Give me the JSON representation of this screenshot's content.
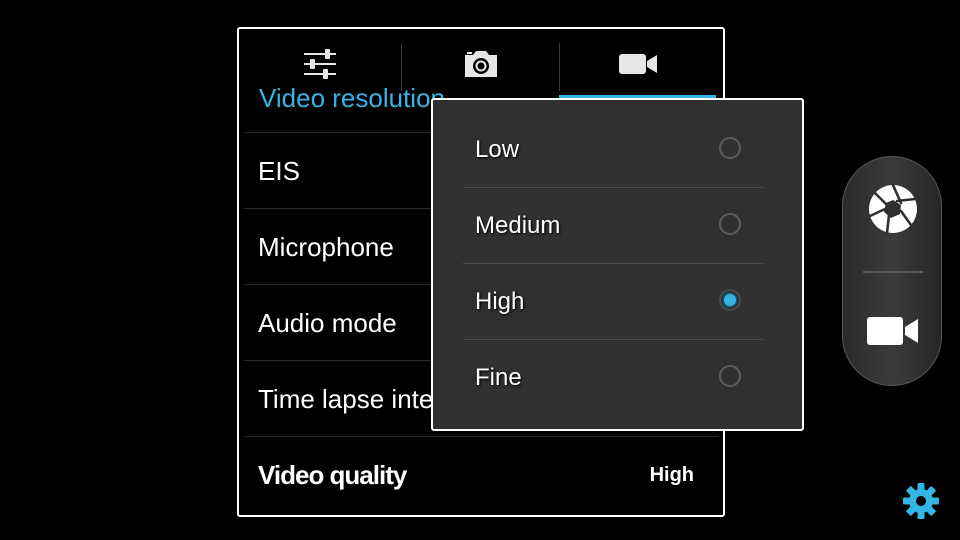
{
  "tabs": [
    {
      "icon": "sliders-icon",
      "active": false
    },
    {
      "icon": "camera-icon",
      "active": false
    },
    {
      "icon": "video-camera-icon",
      "active": true
    }
  ],
  "settings": {
    "partial_row_label": "Video resolution",
    "rows": [
      {
        "label": "EIS",
        "value": ""
      },
      {
        "label": "Microphone",
        "value": ""
      },
      {
        "label": "Audio mode",
        "value": ""
      },
      {
        "label": "Time lapse interval",
        "value": ""
      },
      {
        "label": "Video quality",
        "value": "High"
      }
    ]
  },
  "quality_popup": {
    "options": [
      {
        "label": "Low",
        "selected": false
      },
      {
        "label": "Medium",
        "selected": false
      },
      {
        "label": "High",
        "selected": true
      },
      {
        "label": "Fine",
        "selected": false
      }
    ]
  },
  "mode_switcher": {
    "modes": [
      "shutter-icon",
      "video-camera-icon"
    ]
  },
  "settings_button": {
    "icon": "gear-icon"
  },
  "colors": {
    "accent": "#33b5e5",
    "popup_bg": "#303030",
    "background": "#000000"
  }
}
